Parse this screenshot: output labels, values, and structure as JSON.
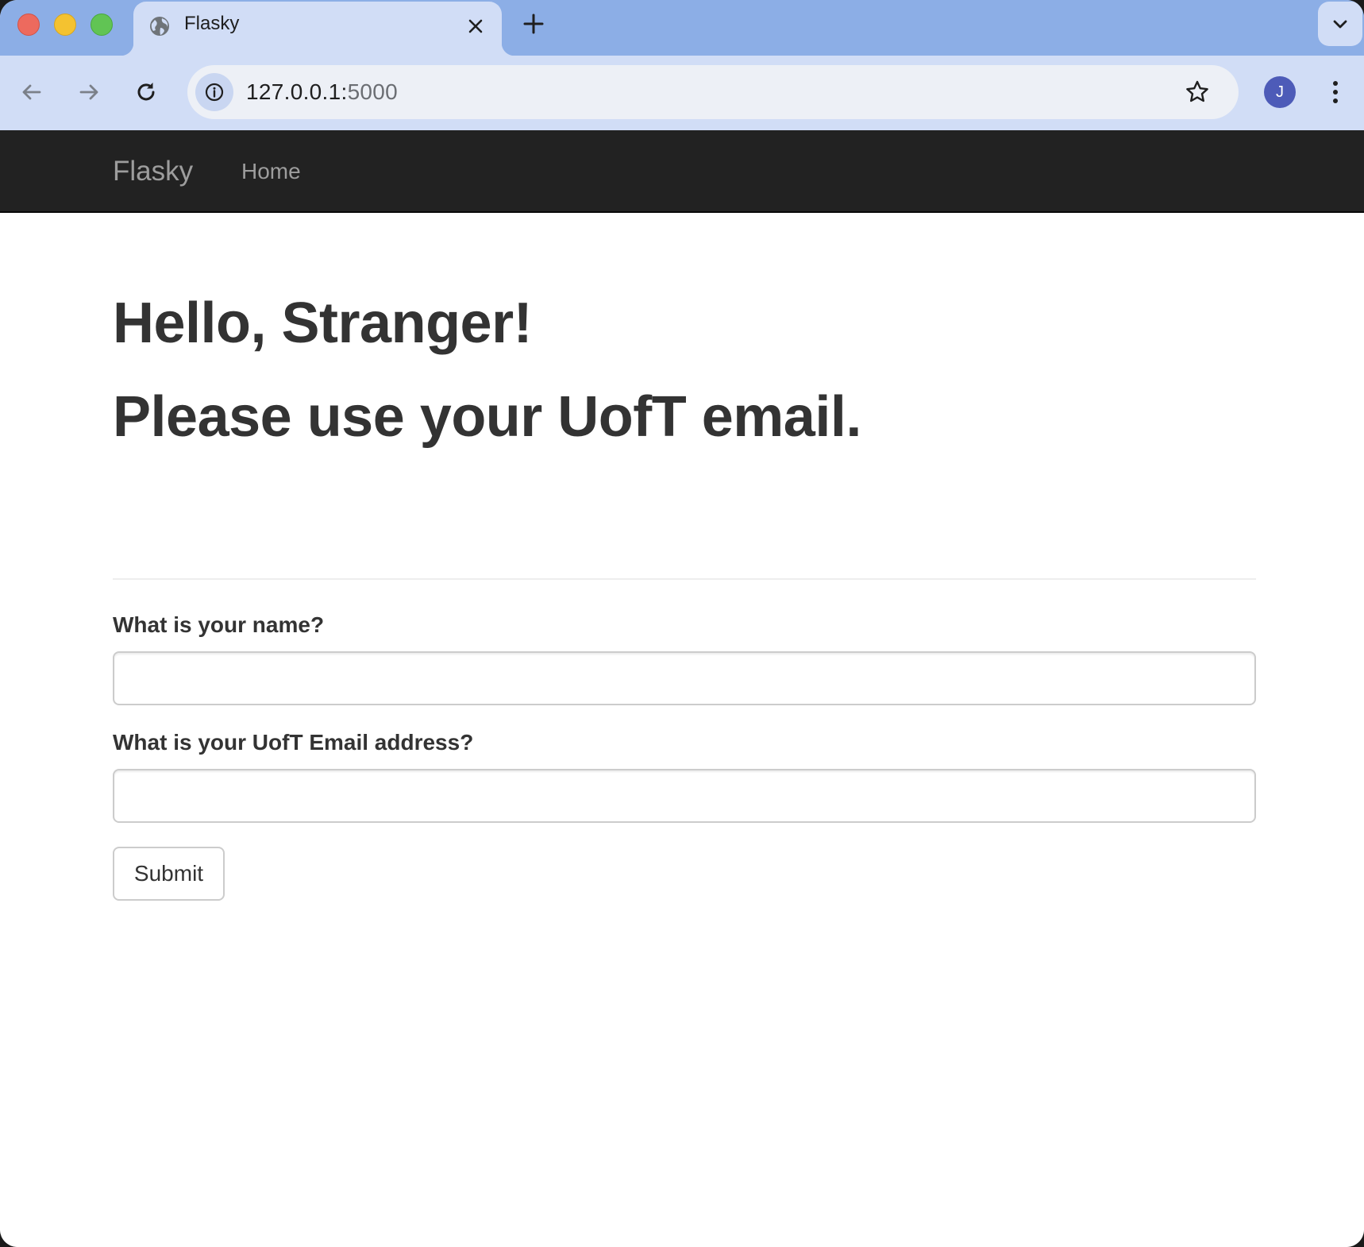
{
  "browser": {
    "tab_title": "Flasky",
    "url_host": "127.0.0.1:",
    "url_port": "5000",
    "profile_initial": "J"
  },
  "navbar": {
    "brand": "Flasky",
    "links": [
      {
        "label": "Home"
      }
    ]
  },
  "main": {
    "greeting": "Hello, Stranger!",
    "instruction": "Please use your UofT email.",
    "form": {
      "name_label": "What is your name?",
      "name_value": "",
      "email_label": "What is your UofT Email address?",
      "email_value": "",
      "submit_label": "Submit"
    }
  },
  "icons": {
    "favicon": "globe-icon",
    "tab_close": "close-icon",
    "new_tab": "plus-icon",
    "tab_search": "chevron-down-icon",
    "back": "arrow-left-icon",
    "forward": "arrow-right-icon",
    "reload": "reload-icon",
    "site_info": "info-icon",
    "bookmark": "star-icon",
    "menu": "kebab-menu-icon"
  },
  "colors": {
    "tab_strip": "#8caee6",
    "toolbar": "#d1ddf6",
    "navbar_bg": "#222222",
    "navbar_text": "#9d9d9d",
    "heading_text": "#333333"
  }
}
